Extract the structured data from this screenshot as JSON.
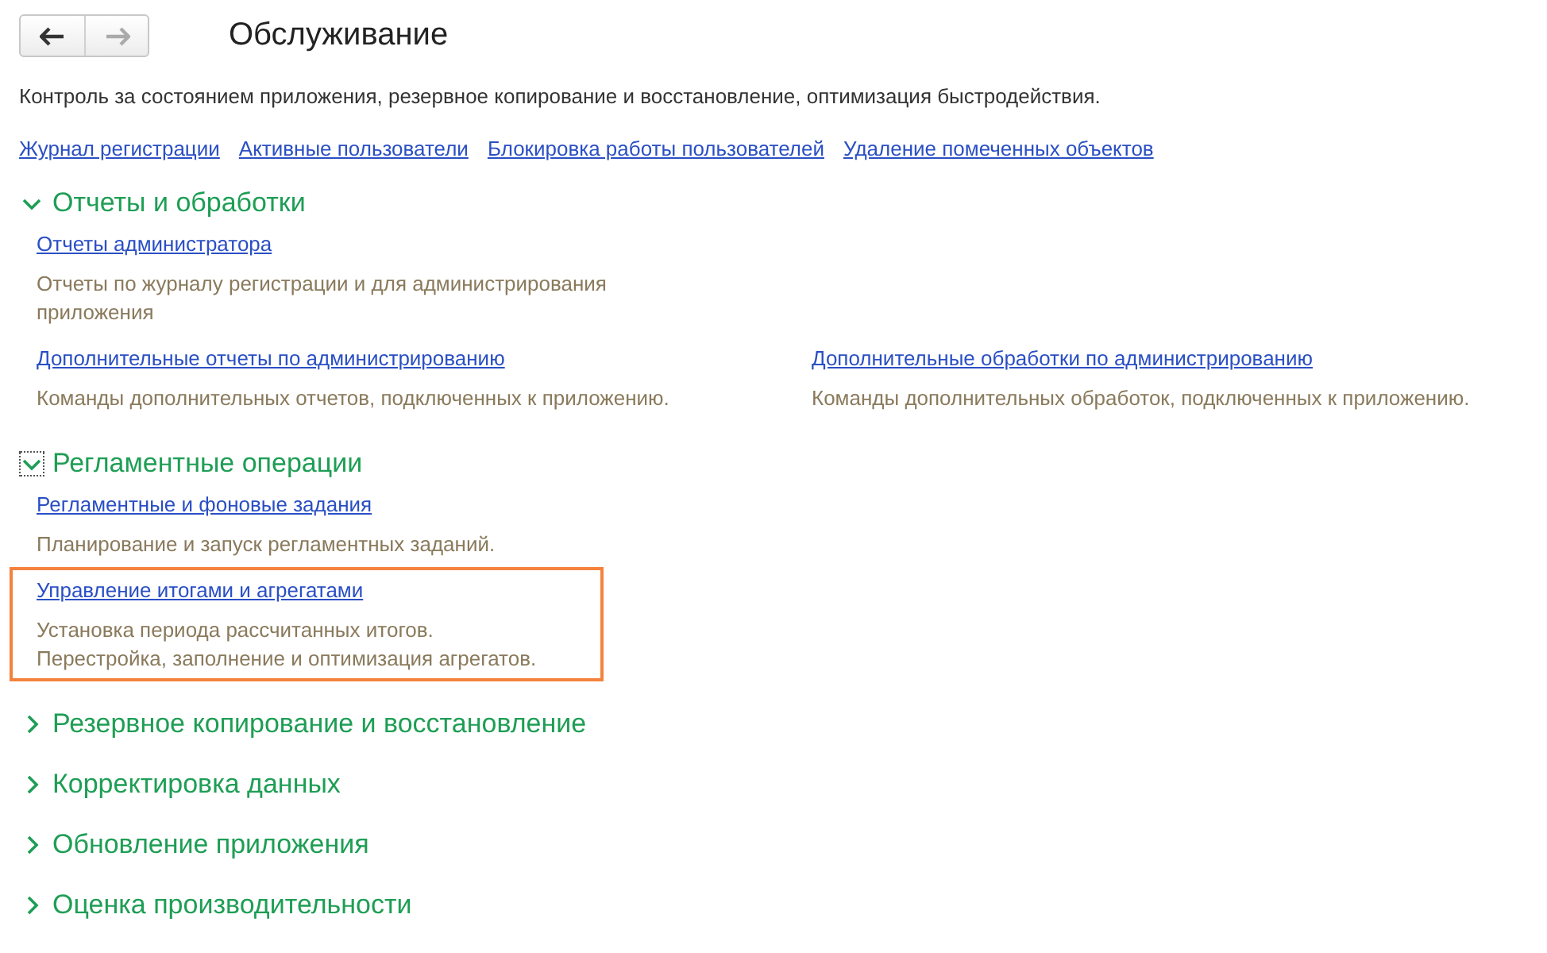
{
  "nav": {
    "back_enabled": true,
    "forward_enabled": false
  },
  "title": "Обслуживание",
  "description": "Контроль за состоянием приложения, резервное копирование и восстановление, оптимизация быстродействия.",
  "links": [
    "Журнал регистрации",
    "Активные пользователи",
    "Блокировка работы пользователей",
    "Удаление помеченных объектов"
  ],
  "sections": [
    {
      "title": "Отчеты и обработки",
      "expanded": true,
      "focused": false,
      "rows": [
        [
          {
            "link": "Отчеты администратора",
            "text": "Отчеты по журналу регистрации и для администрирования приложения",
            "highlighted": false
          }
        ],
        [
          {
            "link": "Дополнительные отчеты по администрированию",
            "text": "Команды дополнительных отчетов, подключенных к приложению.",
            "highlighted": false
          },
          {
            "link": "Дополнительные обработки по администрированию",
            "text": "Команды дополнительных обработок, подключенных к приложению.",
            "highlighted": false
          }
        ]
      ]
    },
    {
      "title": "Регламентные операции",
      "expanded": true,
      "focused": true,
      "rows": [
        [
          {
            "link": "Регламентные и фоновые задания",
            "text": "Планирование и запуск регламентных заданий.",
            "highlighted": false
          }
        ],
        [
          {
            "link": "Управление итогами и агрегатами",
            "text": "Установка периода рассчитанных итогов.\nПерестройка, заполнение и оптимизация агрегатов.",
            "highlighted": true
          }
        ]
      ]
    },
    {
      "title": "Резервное копирование и восстановление",
      "expanded": false,
      "focused": false
    },
    {
      "title": "Корректировка данных",
      "expanded": false,
      "focused": false
    },
    {
      "title": "Обновление приложения",
      "expanded": false,
      "focused": false
    },
    {
      "title": "Оценка производительности",
      "expanded": false,
      "focused": false
    }
  ]
}
